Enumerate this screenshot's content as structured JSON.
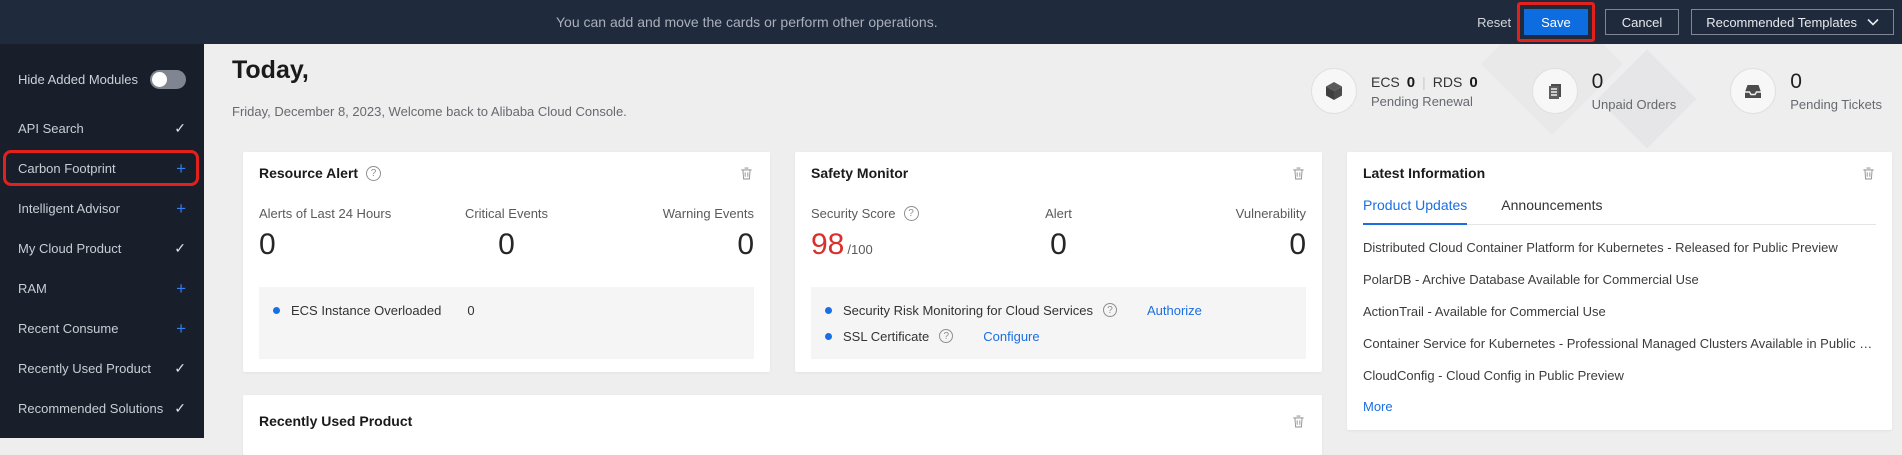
{
  "topbar": {
    "message": "You can add and move the cards or perform other operations.",
    "reset_label": "Reset",
    "save_label": "Save",
    "cancel_label": "Cancel",
    "templates_label": "Recommended Templates"
  },
  "sidebar": {
    "hide_toggle_label": "Hide Added Modules",
    "items": [
      {
        "label": "API Search",
        "state": "added"
      },
      {
        "label": "Carbon Footprint",
        "state": "addable",
        "highlighted": true
      },
      {
        "label": "Intelligent Advisor",
        "state": "addable"
      },
      {
        "label": "My Cloud Product",
        "state": "added"
      },
      {
        "label": "RAM",
        "state": "addable"
      },
      {
        "label": "Recent Consume",
        "state": "addable"
      },
      {
        "label": "Recently Used Product",
        "state": "added"
      },
      {
        "label": "Recommended Solutions",
        "state": "added"
      }
    ]
  },
  "header": {
    "greeting": "Today,",
    "subtitle": "Friday, December 8, 2023, Welcome back to Alibaba Cloud Console.",
    "stats": {
      "renewal": {
        "ecs_label": "ECS",
        "ecs_value": "0",
        "rds_label": "RDS",
        "rds_value": "0",
        "label": "Pending Renewal"
      },
      "orders": {
        "value": "0",
        "label": "Unpaid Orders"
      },
      "tickets": {
        "value": "0",
        "label": "Pending Tickets"
      }
    }
  },
  "cards": {
    "resource_alert": {
      "title": "Resource Alert",
      "metrics": [
        {
          "label": "Alerts of Last 24 Hours",
          "value": "0"
        },
        {
          "label": "Critical Events",
          "value": "0"
        },
        {
          "label": "Warning Events",
          "value": "0"
        }
      ],
      "items": [
        {
          "label": "ECS Instance Overloaded",
          "value": "0"
        }
      ]
    },
    "safety_monitor": {
      "title": "Safety Monitor",
      "score_label": "Security Score",
      "score_value": "98",
      "score_suffix": "/100",
      "metrics": [
        {
          "label": "Alert",
          "value": "0"
        },
        {
          "label": "Vulnerability",
          "value": "0"
        }
      ],
      "items": [
        {
          "label": "Security Risk Monitoring for Cloud Services",
          "link": "Authorize"
        },
        {
          "label": "SSL Certificate",
          "link": "Configure"
        }
      ]
    },
    "latest_information": {
      "title": "Latest Information",
      "tabs": [
        {
          "label": "Product Updates",
          "active": true
        },
        {
          "label": "Announcements",
          "active": false
        }
      ],
      "news": [
        "Distributed Cloud Container Platform for Kubernetes - Released for Public Preview",
        "PolarDB - Archive Database Available for Commercial Use",
        "ActionTrail - Available for Commercial Use",
        "Container Service for Kubernetes - Professional Managed Clusters Available in Public Pre...",
        "CloudConfig - Cloud Config in Public Preview"
      ],
      "more_label": "More"
    },
    "recently_used": {
      "title": "Recently Used Product"
    }
  },
  "icons": {
    "check": "✓",
    "plus": "+",
    "help": "?",
    "divider": "|"
  },
  "colors": {
    "accent_blue": "#1b6fe0",
    "save_blue": "#0d6cdf",
    "score_red": "#d9302c",
    "annotation_red": "#e2211c"
  }
}
